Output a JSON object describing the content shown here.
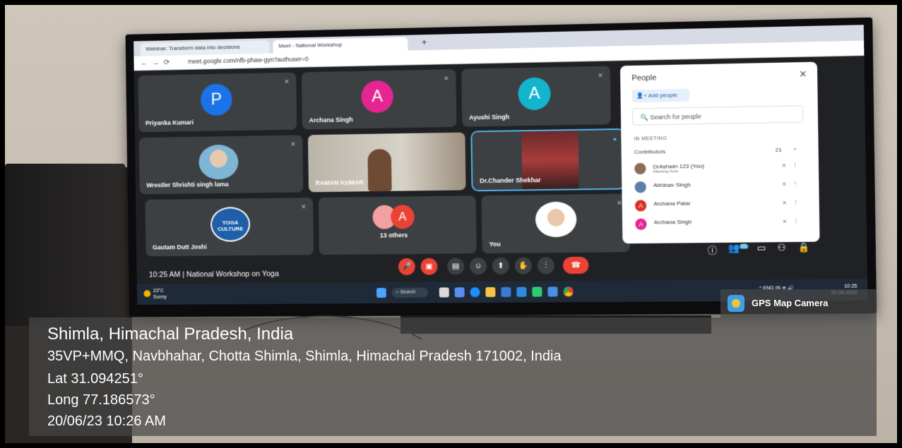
{
  "browser": {
    "tabs": [
      "Webinar: Transform data into decisions",
      "Meet - National Workshop"
    ],
    "url": "meet.google.com/nfb-phaw-gyn?authuser=0"
  },
  "meet": {
    "tiles": [
      {
        "name": "Priyanka Kumari",
        "initial": "P",
        "color": "#1a73e8"
      },
      {
        "name": "Archana Singh",
        "initial": "A",
        "color": "#e52592"
      },
      {
        "name": "Ayushi Singh",
        "initial": "A",
        "color": "#12b5cb"
      },
      {
        "name": "Wrestler Shrishti singh lama"
      },
      {
        "name": "RAMAN KUMAR"
      },
      {
        "name": "Dr.Chander Shekhar"
      },
      {
        "name": "Gautam Dutt Joshi",
        "logo_text": "YOGA CULTURE"
      },
      {
        "name": "13 others",
        "initial": "A",
        "color": "#ea4335"
      },
      {
        "name": "You"
      }
    ],
    "people_panel": {
      "title": "People",
      "add_people": "Add people",
      "search_placeholder": "Search for people",
      "section": "IN MEETING",
      "group": "Contributors",
      "count": "21",
      "members": [
        {
          "name": "DrAshwin 123 (You)",
          "sub": "Meeting host",
          "color": "#8a6d5a"
        },
        {
          "name": "Abhinav Singh",
          "color": "#5b7fa6"
        },
        {
          "name": "Archana Patar",
          "initial": "A",
          "color": "#d93025"
        },
        {
          "name": "Archana Singh",
          "initial": "A",
          "color": "#e52592"
        }
      ]
    },
    "meeting_info": "10:25 AM  |  National Workshop on Yoga",
    "participant_badge": "21"
  },
  "taskbar": {
    "temp": "23°C",
    "weather": "Sunny",
    "search": "Search",
    "lang": "ENG",
    "region": "IN",
    "clock_time": "10:25",
    "clock_date": "20-06-2023"
  },
  "stamp": {
    "app": "GPS Map Camera",
    "place": "Shimla, Himachal Pradesh, India",
    "address": "35VP+MMQ, Navbhahar, Chotta Shimla, Shimla, Himachal Pradesh 171002, India",
    "lat": "Lat 31.094251°",
    "long": "Long 77.186573°",
    "datetime": "20/06/23 10:26 AM"
  }
}
